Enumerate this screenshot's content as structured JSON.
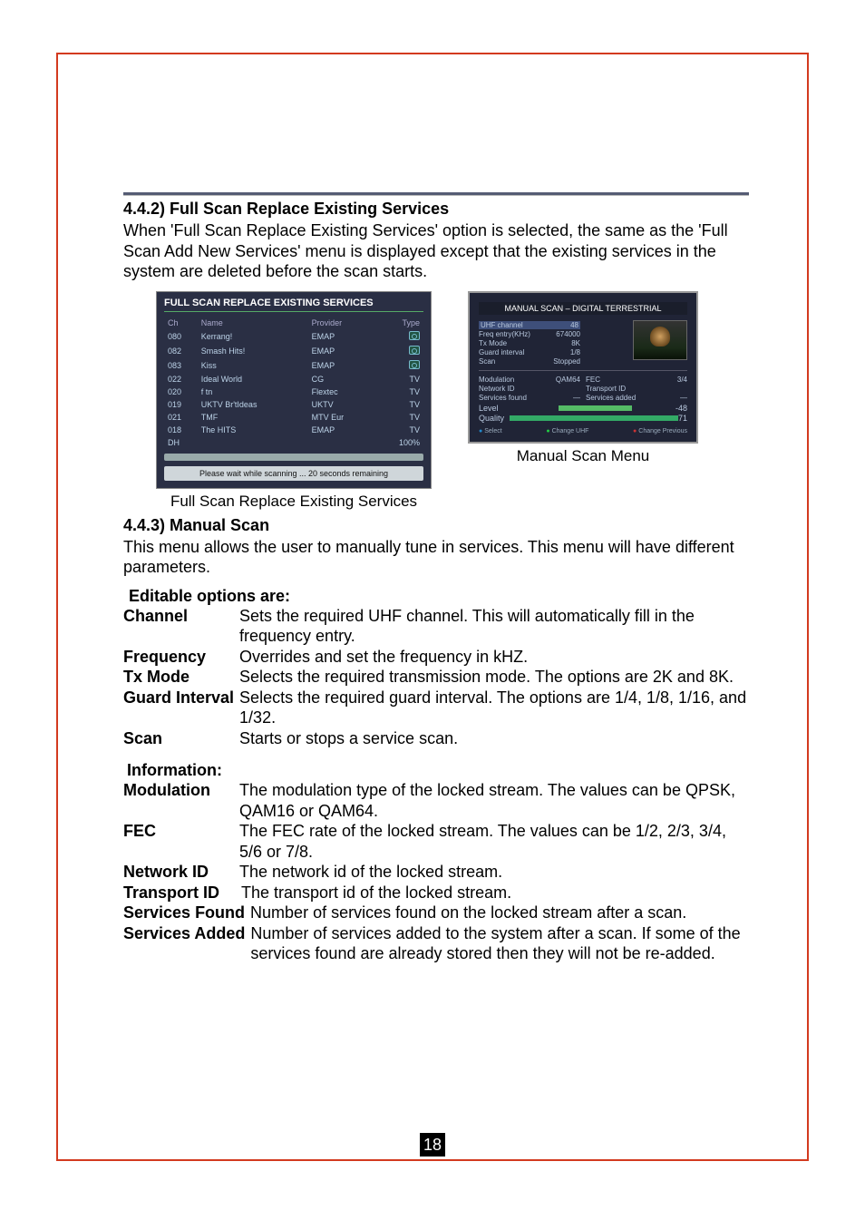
{
  "page_number": "18",
  "sec442": {
    "title": "4.4.2) Full Scan Replace Existing Services",
    "body": "When 'Full Scan Replace Existing Services' option is selected, the same as the 'Full Scan Add New Services' menu is displayed except that the existing services in the system are deleted before the scan starts."
  },
  "fullscan_shot": {
    "title": "FULL SCAN REPLACE EXISTING SERVICES",
    "hdr_ch": "Ch",
    "hdr_name": "Name",
    "hdr_provider": "Provider",
    "hdr_type": "Type",
    "rows": [
      {
        "ch": "080",
        "name": "Kerrang!",
        "prov": "EMAP",
        "type": "radio"
      },
      {
        "ch": "082",
        "name": "Smash Hits!",
        "prov": "EMAP",
        "type": "radio"
      },
      {
        "ch": "083",
        "name": "Kiss",
        "prov": "EMAP",
        "type": "radio"
      },
      {
        "ch": "022",
        "name": "Ideal World",
        "prov": "CG",
        "type": "TV"
      },
      {
        "ch": "020",
        "name": "f tn",
        "prov": "Flextec",
        "type": "TV"
      },
      {
        "ch": "019",
        "name": "UKTV Br'tIdeas",
        "prov": "UKTV",
        "type": "TV"
      },
      {
        "ch": "021",
        "name": "TMF",
        "prov": "MTV Eur",
        "type": "TV"
      },
      {
        "ch": "018",
        "name": "The HITS",
        "prov": "EMAP",
        "type": "TV"
      },
      {
        "ch": "DH",
        "name": "",
        "prov": "",
        "type": "100%"
      }
    ],
    "wait": "Please wait while scanning ... 20 seconds remaining",
    "caption": "Full Scan Replace Existing Services"
  },
  "manual_shot": {
    "title": "MANUAL SCAN – DIGITAL TERRESTRIAL",
    "rows_left": [
      {
        "k": "UHF channel",
        "v": "48"
      },
      {
        "k": "Freq entry(KHz)",
        "v": "674000"
      },
      {
        "k": "Tx Mode",
        "v": "8K"
      },
      {
        "k": "Guard interval",
        "v": "1/8"
      },
      {
        "k": "Scan",
        "v": "Stopped"
      }
    ],
    "rows_mid": [
      {
        "k": "Modulation",
        "v": "QAM64"
      },
      {
        "k": "Network ID",
        "v": ""
      },
      {
        "k": "Services found",
        "v": "—"
      }
    ],
    "rows_right": [
      {
        "k": "FEC",
        "v": "3/4"
      },
      {
        "k": "Transport ID",
        "v": ""
      },
      {
        "k": "Services added",
        "v": "—"
      }
    ],
    "bars": [
      {
        "k": "Level",
        "v": "-48"
      },
      {
        "k": "Quality",
        "v": "71"
      }
    ],
    "foot_select": "Select",
    "foot_change": "Change UHF",
    "foot_prev": "Change Previous",
    "caption": "Manual Scan Menu"
  },
  "sec443": {
    "title": "4.4.3) Manual Scan",
    "body": "This menu allows the user to manually tune in services. This menu will have different parameters."
  },
  "editable_hdr": "Editable options are:",
  "opts": {
    "channel_t": "Channel",
    "channel_d": "Sets the required UHF channel. This will automatically fill in the frequency entry.",
    "freq_t": "Frequency",
    "freq_d": "Overrides and set the frequency in kHZ.",
    "tx_t": "Tx Mode",
    "tx_d": "Selects the required transmission mode. The options are 2K and 8K.",
    "gi_t": "Guard Interval",
    "gi_d": "Selects the required guard interval. The options are 1/4, 1/8, 1/16, and 1/32.",
    "scan_t": "Scan",
    "scan_d": "Starts or stops a service scan."
  },
  "info_hdr": "Information:",
  "info": {
    "mod_t": "Modulation",
    "mod_d": "The modulation type of the locked stream. The values can be QPSK, QAM16 or QAM64.",
    "fec_t": "FEC",
    "fec_d": "The FEC rate of the locked stream. The values can be 1/2, 2/3, 3/4, 5/6 or 7/8.",
    "nid_t": "Network ID",
    "nid_d": "The network id of the locked stream.",
    "tid_t": "Transport ID",
    "tid_d": "The transport id of the locked stream.",
    "sf_t": "Services Found",
    "sf_d": "Number of services found on the locked stream after a scan.",
    "sa_t": "Services Added",
    "sa_d": "Number of services added to the system after a scan. If some of the services found are already stored then they will not be re-added."
  }
}
